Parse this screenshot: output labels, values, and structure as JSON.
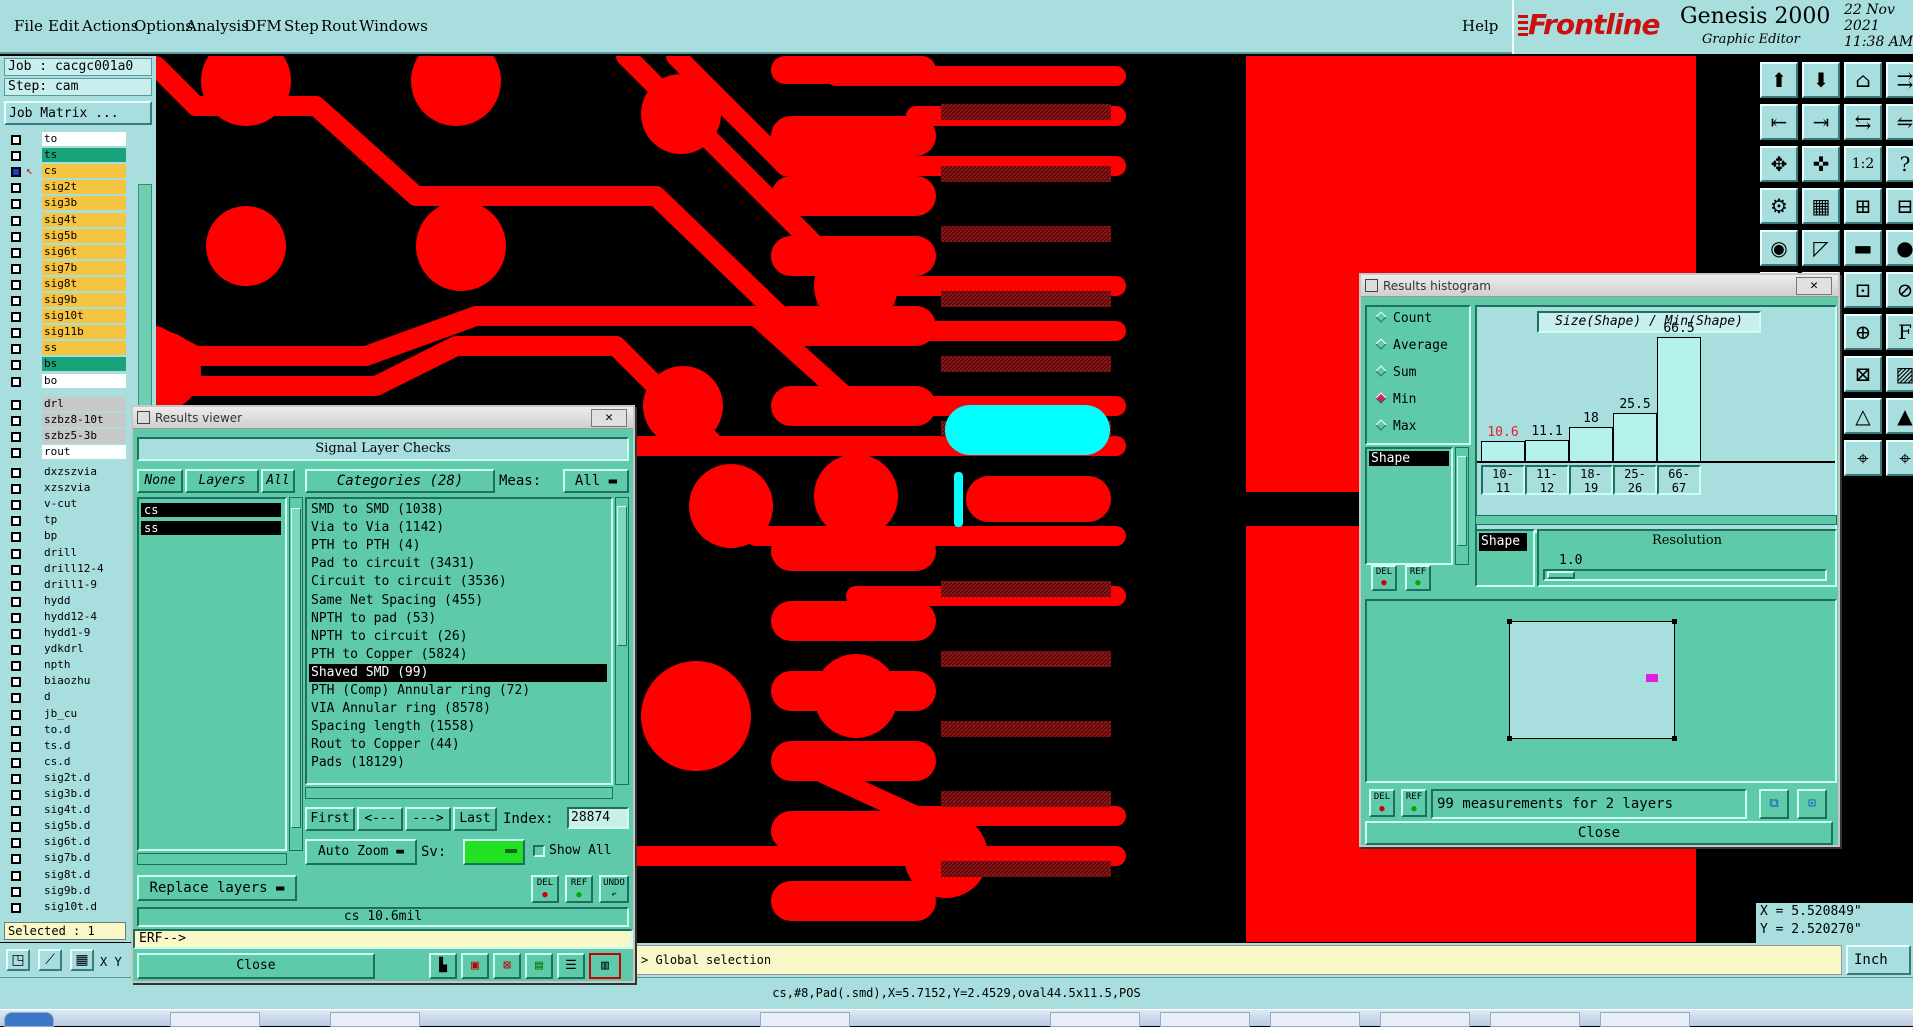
{
  "menu": [
    "File",
    "Edit",
    "Actions",
    "Options",
    "Analysis",
    "DFM",
    "Step",
    "Rout",
    "Windows"
  ],
  "help": "Help",
  "brand": {
    "logo": "Frontline",
    "product": "Genesis 2000",
    "subtitle": "Graphic Editor",
    "date": "22 Nov 2021",
    "time": "11:38 AM"
  },
  "left": {
    "job": "Job : cacgc001a0",
    "step": "Step: cam",
    "job_matrix": "Job Matrix ...",
    "selected": "Selected : 1",
    "layers_group1": [
      {
        "name": "to",
        "color": "#ffffff"
      },
      {
        "name": "ts",
        "color": "#1aa37a"
      },
      {
        "name": "cs",
        "color": "#f5c542"
      },
      {
        "name": "sig2t",
        "color": "#f5c542"
      },
      {
        "name": "sig3b",
        "color": "#f5c542"
      },
      {
        "name": "sig4t",
        "color": "#f5c542"
      },
      {
        "name": "sig5b",
        "color": "#f5c542"
      },
      {
        "name": "sig6t",
        "color": "#f5c542"
      },
      {
        "name": "sig7b",
        "color": "#f5c542"
      },
      {
        "name": "sig8t",
        "color": "#f5c542"
      },
      {
        "name": "sig9b",
        "color": "#f5c542"
      },
      {
        "name": "sig10t",
        "color": "#f5c542"
      },
      {
        "name": "sig11b",
        "color": "#f5c542"
      },
      {
        "name": "ss",
        "color": "#f5c542"
      },
      {
        "name": "bs",
        "color": "#1aa37a"
      },
      {
        "name": "bo",
        "color": "#ffffff"
      }
    ],
    "layers_group2": [
      {
        "name": "drl",
        "color": "#c8c8c8"
      },
      {
        "name": "szbz8-10t",
        "color": "#c8c8c8"
      },
      {
        "name": "szbz5-3b",
        "color": "#c8c8c8"
      },
      {
        "name": "rout",
        "color": "#ffffff"
      }
    ],
    "layers_group3": [
      {
        "name": "dxzszvia",
        "color": "#a8dede"
      },
      {
        "name": "xzszvia",
        "color": "#a8dede"
      },
      {
        "name": "v-cut",
        "color": "#a8dede"
      },
      {
        "name": "tp",
        "color": "#a8dede"
      },
      {
        "name": "bp",
        "color": "#a8dede"
      },
      {
        "name": "drill",
        "color": "#a8dede"
      },
      {
        "name": "drill12-4",
        "color": "#a8dede"
      },
      {
        "name": "drill1-9",
        "color": "#a8dede"
      },
      {
        "name": "hydd",
        "color": "#a8dede"
      },
      {
        "name": "hydd12-4",
        "color": "#a8dede"
      },
      {
        "name": "hydd1-9",
        "color": "#a8dede"
      },
      {
        "name": "ydkdrl",
        "color": "#a8dede"
      },
      {
        "name": "npth",
        "color": "#a8dede"
      },
      {
        "name": "biaozhu",
        "color": "#a8dede"
      },
      {
        "name": "d",
        "color": "#a8dede"
      },
      {
        "name": "jb_cu",
        "color": "#a8dede"
      },
      {
        "name": "to.d",
        "color": "#a8dede"
      },
      {
        "name": "ts.d",
        "color": "#a8dede"
      },
      {
        "name": "cs.d",
        "color": "#a8dede"
      },
      {
        "name": "sig2t.d",
        "color": "#a8dede"
      },
      {
        "name": "sig3b.d",
        "color": "#a8dede"
      },
      {
        "name": "sig4t.d",
        "color": "#a8dede"
      },
      {
        "name": "sig5b.d",
        "color": "#a8dede"
      },
      {
        "name": "sig6t.d",
        "color": "#a8dede"
      },
      {
        "name": "sig7b.d",
        "color": "#a8dede"
      },
      {
        "name": "sig8t.d",
        "color": "#a8dede"
      },
      {
        "name": "sig9b.d",
        "color": "#a8dede"
      },
      {
        "name": "sig10t.d",
        "color": "#a8dede"
      }
    ]
  },
  "results_viewer": {
    "title": "Results viewer",
    "close_x": "✕",
    "header": "Signal Layer Checks",
    "none_btn": "None",
    "layers_btn": "Layers",
    "all_btn": "All",
    "layers": [
      "cs",
      "ss"
    ],
    "categories_btn": "Categories (28)",
    "meas_label": "Meas:",
    "meas_value": "All",
    "categories": [
      "SMD to SMD (1038)",
      "Via to Via (1142)",
      "PTH to PTH (4)",
      "Pad to circuit (3431)",
      "Circuit to circuit (3536)",
      "Same Net Spacing (455)",
      "NPTH to pad (53)",
      "NPTH to circuit (26)",
      "PTH to Copper (5824)",
      "Shaved SMD (99)",
      "PTH (Comp) Annular ring (72)",
      "VIA Annular ring (8578)",
      "Spacing length (1558)",
      "Rout to Copper (44)",
      "Pads (18129)"
    ],
    "selected_category": "Shaved SMD (99)",
    "first": "First",
    "prev": "<---",
    "next": "--->",
    "last": "Last",
    "index_label": "Index:",
    "index_value": "28874",
    "auto_zoom": "Auto Zoom",
    "sv_label": "Sv:",
    "show_all": "Show All",
    "replace_layers": "Replace layers",
    "del": "DEL",
    "ref": "REF",
    "undo": "UNDO",
    "status": "cs 10.6mil",
    "erf": "ERF-->",
    "close": "Close"
  },
  "histogram": {
    "title": "Results histogram",
    "close_x": "✕",
    "radios": [
      "Count",
      "Average",
      "Sum",
      "Min",
      "Max"
    ],
    "radio_selected": "Min",
    "shape_item": "Shape",
    "chart_title": "Size(Shape) / Min(Shape)",
    "del": "DEL",
    "ref": "REF",
    "shape_label": "Shape",
    "resolution_label": "Resolution",
    "resolution_value": "1.0",
    "measurements": "99 measurements for 2 layers",
    "close": "Close",
    "chart_data": {
      "type": "bar",
      "categories": [
        "10-11",
        "11-12",
        "18-19",
        "25-26",
        "66-67"
      ],
      "values": [
        10.6,
        11.1,
        18,
        25.5,
        66.5
      ],
      "value_labels": [
        "10.6",
        "11.1",
        "18",
        "25.5",
        "66.5"
      ],
      "title": "Size(Shape) / Min(Shape)",
      "highlight_color": "#e0202a",
      "bar_color": "#b4f0ec"
    }
  },
  "right": {
    "x": "X = 5.520849\"",
    "y": "Y = 2.520270\""
  },
  "bottom": {
    "xy": "X Y",
    "message": "> Global selection",
    "unit": "Inch",
    "status": "cs,#8,Pad(.smd),X=5.7152,Y=2.4529,oval44.5x11.5,POS"
  },
  "colors": {
    "copper": "#ff0000",
    "highlight": "#00ffff",
    "panel": "#a8dede",
    "dialog": "#5ecaaa"
  }
}
